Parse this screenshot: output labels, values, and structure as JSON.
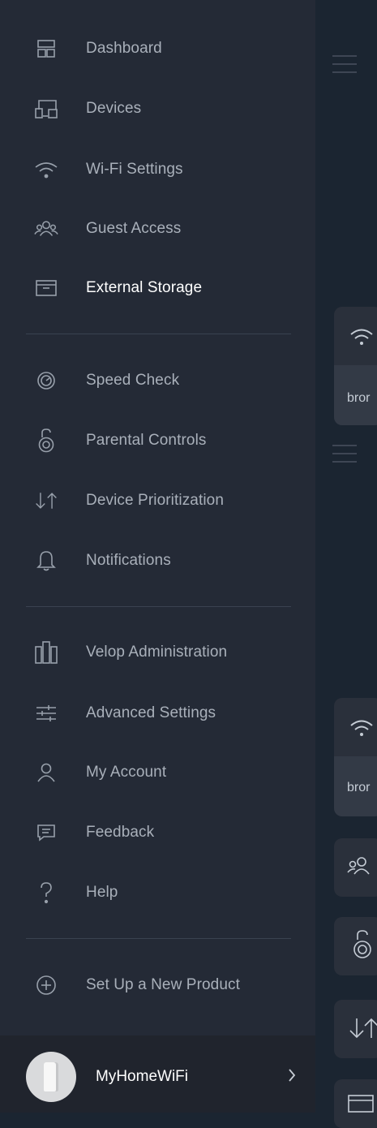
{
  "menu": {
    "group1": [
      {
        "label": "Dashboard",
        "icon": "dashboard-icon"
      },
      {
        "label": "Devices",
        "icon": "devices-icon"
      },
      {
        "label": "Wi-Fi Settings",
        "icon": "wifi-icon"
      },
      {
        "label": "Guest Access",
        "icon": "guest-access-icon"
      },
      {
        "label": "External Storage",
        "icon": "external-storage-icon",
        "active": true
      }
    ],
    "group2": [
      {
        "label": "Speed Check",
        "icon": "speedometer-icon"
      },
      {
        "label": "Parental Controls",
        "icon": "parental-lock-icon"
      },
      {
        "label": "Device Prioritization",
        "icon": "priority-arrows-icon"
      },
      {
        "label": "Notifications",
        "icon": "bell-icon"
      }
    ],
    "group3": [
      {
        "label": "Velop Administration",
        "icon": "velop-nodes-icon"
      },
      {
        "label": "Advanced Settings",
        "icon": "sliders-icon"
      },
      {
        "label": "My Account",
        "icon": "user-icon"
      },
      {
        "label": "Feedback",
        "icon": "chat-bubble-icon"
      },
      {
        "label": "Help",
        "icon": "question-mark-icon"
      }
    ],
    "group4": [
      {
        "label": "Set Up a New Product",
        "icon": "plus-circle-icon"
      }
    ]
  },
  "footer": {
    "network_name": "MyHomeWiFi",
    "chevron_icon": "chevron-right-icon"
  },
  "background": {
    "card1_text": "bror",
    "card2_text": "bror"
  },
  "colors": {
    "drawer_bg": "#242a36",
    "page_bg": "#1b2531",
    "label": "#a9b0ba",
    "label_active": "#ffffff",
    "icon": "#98a0ab"
  }
}
